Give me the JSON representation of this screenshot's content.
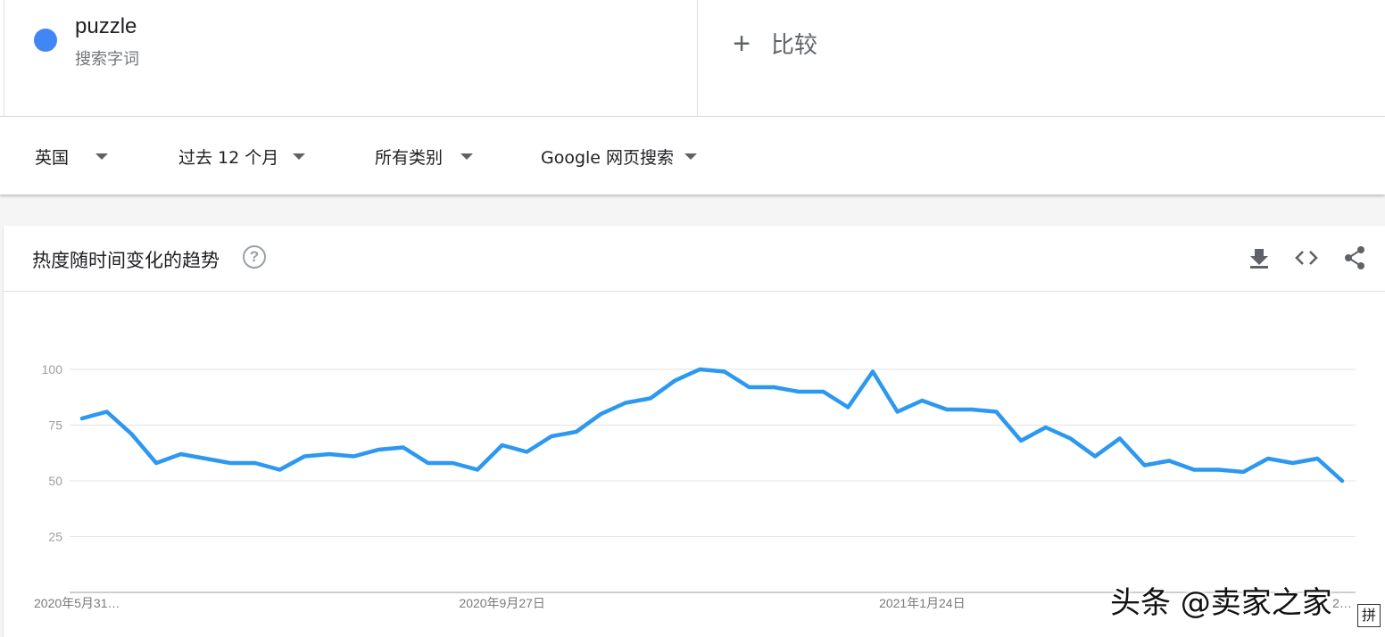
{
  "term": {
    "name": "puzzle",
    "subtitle": "搜索字词",
    "color": "#4285f4"
  },
  "compare": {
    "plus": "+",
    "label": "比较"
  },
  "filters": [
    {
      "label": "英国"
    },
    {
      "label": "过去 12 个月"
    },
    {
      "label": "所有类别"
    },
    {
      "label": "Google 网页搜索"
    }
  ],
  "card": {
    "title": "热度随时间变化的趋势",
    "help_icon": "?",
    "icons": [
      "download-icon",
      "embed-code-icon",
      "share-icon"
    ]
  },
  "watermark": "头条 @卖家之家",
  "ime_badge": "拼",
  "chart_data": {
    "type": "line",
    "line_color": "#2c98f0",
    "grid": true,
    "ylim": [
      0,
      100
    ],
    "yticks": [
      25,
      50,
      75,
      100
    ],
    "xlabels": [
      {
        "index": 0,
        "label": "2020年5月31…"
      },
      {
        "index": 17,
        "label": "2020年9月27日"
      },
      {
        "index": 34,
        "label": "2021年1月24日"
      },
      {
        "index": 51,
        "label": "2…"
      }
    ],
    "values": [
      78,
      81,
      71,
      58,
      62,
      60,
      58,
      58,
      55,
      61,
      62,
      61,
      64,
      65,
      58,
      58,
      55,
      66,
      63,
      70,
      72,
      80,
      85,
      87,
      95,
      100,
      99,
      92,
      92,
      90,
      90,
      83,
      99,
      81,
      86,
      82,
      82,
      81,
      68,
      74,
      69,
      61,
      69,
      57,
      59,
      55,
      55,
      54,
      60,
      58,
      60,
      50
    ]
  }
}
